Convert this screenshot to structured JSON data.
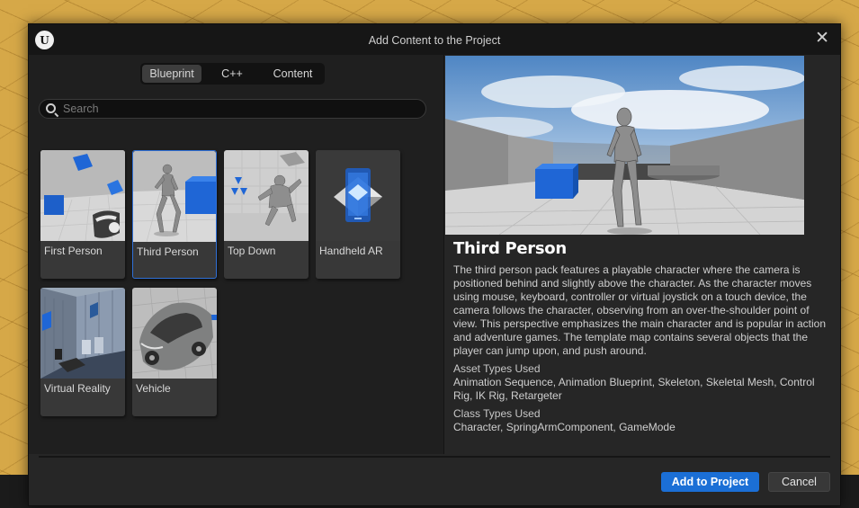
{
  "dialog": {
    "title": "Add Content to the Project",
    "logo_icon": "unreal-engine-logo",
    "close_icon": "close-icon",
    "close_glyph": "✕"
  },
  "tabs": [
    {
      "label": "Blueprint",
      "selected": true
    },
    {
      "label": "C++",
      "selected": false
    },
    {
      "label": "Content",
      "selected": false
    }
  ],
  "search": {
    "placeholder": "Search",
    "value": ""
  },
  "templates": [
    {
      "label": "First Person",
      "selected": false
    },
    {
      "label": "Third Person",
      "selected": true
    },
    {
      "label": "Top Down",
      "selected": false
    },
    {
      "label": "Handheld AR",
      "selected": false
    },
    {
      "label": "Virtual Reality",
      "selected": false
    },
    {
      "label": "Vehicle",
      "selected": false
    }
  ],
  "details": {
    "title": "Third Person",
    "description": "The third person pack features a playable character where the camera is positioned behind and slightly above the character. As the character moves using mouse, keyboard, controller or virtual joystick on a touch device, the camera follows the character, observing from an over-the-shoulder point of view. This perspective emphasizes the main character and is popular in action and adventure games. The template map contains several objects that the player can jump upon, and push around.",
    "asset_types_heading": "Asset Types Used",
    "asset_types": "Animation Sequence, Animation Blueprint, Skeleton, Skeletal Mesh, Control Rig, IK Rig, Retargeter",
    "class_types_heading": "Class Types Used",
    "class_types": "Character, SpringArmComponent, GameMode"
  },
  "buttons": {
    "add": "Add to Project",
    "cancel": "Cancel"
  },
  "colors": {
    "accent_blue": "#1b6fd6",
    "selected_border": "#2f6fd6",
    "dialog_bg": "#262626",
    "cube_blue": "#1f66d6"
  }
}
